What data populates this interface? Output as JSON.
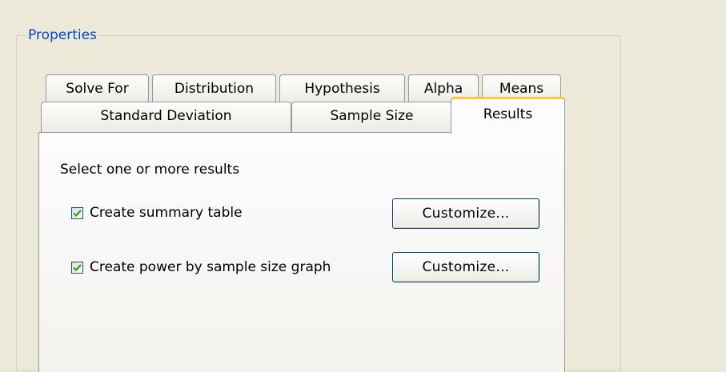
{
  "groupbox": {
    "title": "Properties"
  },
  "tabs_row1": [
    "Solve For",
    "Distribution",
    "Hypothesis",
    "Alpha",
    "Means"
  ],
  "tabs_row2": [
    "Standard Deviation",
    "Sample Size",
    "Results"
  ],
  "active_tab": "Results",
  "results": {
    "prompt": "Select one or more results",
    "options": [
      {
        "label": "Create summary table",
        "checked": true,
        "button": "Customize..."
      },
      {
        "label": "Create power by sample size graph",
        "checked": true,
        "button": "Customize..."
      }
    ]
  },
  "colors": {
    "accent": "#0046d5",
    "active_tab_highlight": "#ffc83c",
    "check_mark": "#21a121"
  },
  "icons": {
    "check": "check-icon"
  }
}
